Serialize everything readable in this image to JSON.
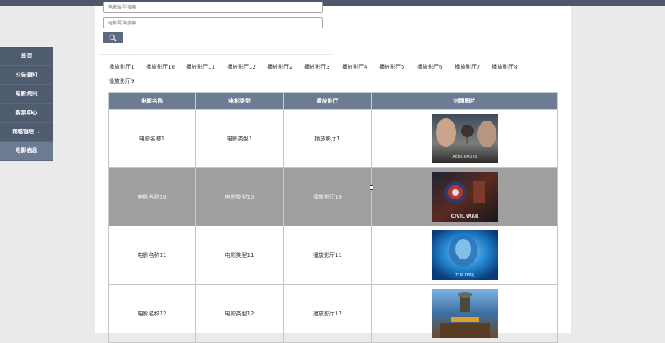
{
  "sidebar": {
    "items": [
      {
        "label": "首页"
      },
      {
        "label": "公告通知"
      },
      {
        "label": "电影资讯"
      },
      {
        "label": "购票中心"
      },
      {
        "label": "商城管理",
        "chevron": "chevron-down-icon"
      },
      {
        "label": "电影信息"
      }
    ]
  },
  "search": {
    "field1_placeholder": "电影类型搜索",
    "field2_placeholder": "电影导演搜索",
    "button_icon": "search-icon"
  },
  "tabs": [
    "播放影厅1",
    "播放影厅10",
    "播放影厅11",
    "播放影厅12",
    "播放影厅2",
    "播放影厅3",
    "播放影厅4",
    "播放影厅5",
    "播放影厅6",
    "播放影厅7",
    "播放影厅8",
    "播放影厅9"
  ],
  "table": {
    "headers": [
      "电影名称",
      "电影类型",
      "播放影厅",
      "封面图片"
    ],
    "rows": [
      {
        "name": "电影名称1",
        "type": "电影类型1",
        "hall": "播放影厅1",
        "poster_text": "AERONAUTS"
      },
      {
        "name": "电影名称10",
        "type": "电影类型10",
        "hall": "播放影厅10",
        "poster_text": "CIVIL WAR"
      },
      {
        "name": "电影名称11",
        "type": "电影类型11",
        "hall": "播放影厅11",
        "poster_text": "THE PROJ"
      },
      {
        "name": "电影名称12",
        "type": "电影类型12",
        "hall": "播放影厅12",
        "poster_text": ""
      }
    ]
  },
  "colors": {
    "sidebar_bg": "#4f5b6e",
    "sidebar_active": "#6c7a92",
    "header_bg": "#6d7b93",
    "accent": "#5c6b82",
    "highlight_row": "#a0a0a0"
  }
}
